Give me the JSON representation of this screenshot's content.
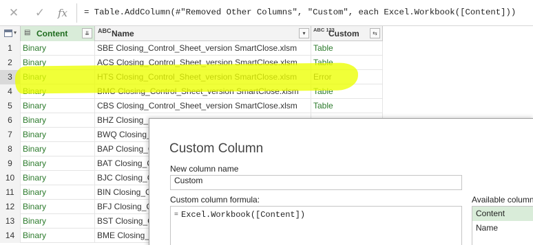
{
  "formula_bar": {
    "cancel_icon": "close-x-icon",
    "ok_icon": "checkmark-icon",
    "fx_label": "fx",
    "formula": "= Table.AddColumn(#\"Removed Other Columns\", \"Custom\", each Excel.Workbook([Content]))"
  },
  "grid": {
    "columns": {
      "content": {
        "type_glyph": "▤",
        "label": "Content",
        "button": "⇊"
      },
      "name": {
        "type_glyph": "ABC",
        "label": "Name",
        "button": "▾"
      },
      "custom": {
        "type_glyph": "ABC 123",
        "label": "Custom",
        "button": "⇆"
      }
    },
    "rows": [
      {
        "num": "1",
        "content": "Binary",
        "name": "SBE Closing_Control_Sheet_version SmartClose.xlsm",
        "custom": "Table"
      },
      {
        "num": "2",
        "content": "Binary",
        "name": "ACS Closing_Control_Sheet_version SmartClose.xlsm",
        "custom": "Table"
      },
      {
        "num": "3",
        "content": "Binary",
        "name": "HTS Closing_Control_Sheet_version SmartClose.xlsm",
        "custom": "Error"
      },
      {
        "num": "4",
        "content": "Binary",
        "name": "BMC Closing_Control_Sheet_version SmartClose.xlsm",
        "custom": "Table"
      },
      {
        "num": "5",
        "content": "Binary",
        "name": "CBS Closing_Control_Sheet_version SmartClose.xlsm",
        "custom": "Table"
      },
      {
        "num": "6",
        "content": "Binary",
        "name": "BHZ Closing_",
        "custom": ""
      },
      {
        "num": "7",
        "content": "Binary",
        "name": "BWQ Closing_",
        "custom": ""
      },
      {
        "num": "8",
        "content": "Binary",
        "name": "BAP Closing_Co",
        "custom": ""
      },
      {
        "num": "9",
        "content": "Binary",
        "name": "BAT Closing_Co",
        "custom": ""
      },
      {
        "num": "10",
        "content": "Binary",
        "name": "BJC Closing_Co",
        "custom": ""
      },
      {
        "num": "11",
        "content": "Binary",
        "name": "BIN Closing_Co",
        "custom": ""
      },
      {
        "num": "12",
        "content": "Binary",
        "name": "BFJ Closing_Co",
        "custom": ""
      },
      {
        "num": "13",
        "content": "Binary",
        "name": "BST Closing_Co",
        "custom": ""
      },
      {
        "num": "14",
        "content": "Binary",
        "name": "BME Closing_Co",
        "custom": ""
      }
    ],
    "selected_row": "3",
    "highlight_color": "#ecff00"
  },
  "dialog": {
    "title": "Custom Column",
    "new_column_label": "New column name",
    "new_column_value": "Custom",
    "formula_label": "Custom column formula:",
    "formula_eq": "=",
    "formula_value": "Excel.Workbook([Content])",
    "available_label": "Available columns",
    "available_columns": [
      "Content",
      "Name"
    ]
  },
  "colors": {
    "accent_green": "#2b7a2b",
    "selected_header": "#d9ecd9"
  }
}
